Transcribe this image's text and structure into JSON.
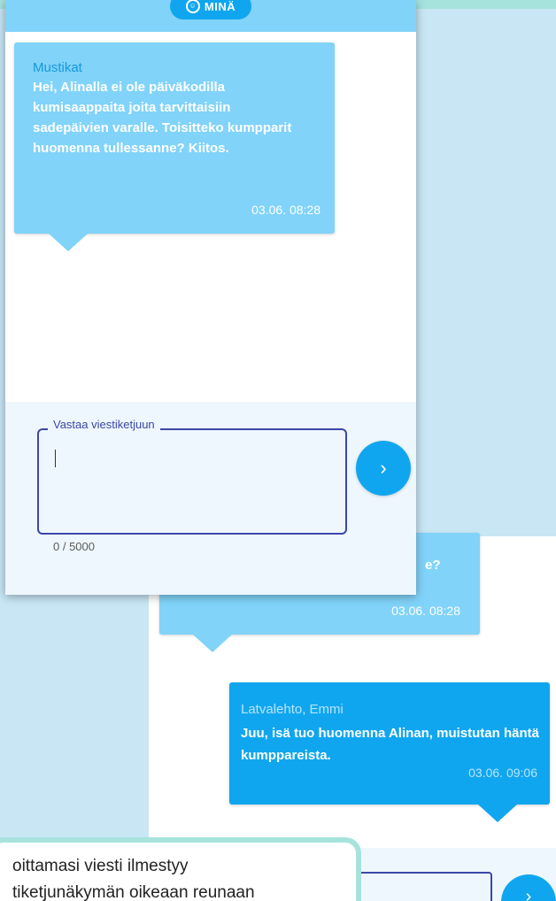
{
  "header": {
    "mina_label": "MINÄ",
    "face_icon": "☺"
  },
  "message": {
    "sender": "Mustikat",
    "body": "Hei, Alinalla ei ole päiväkodilla kumisaappaita joita tarvittaisiin sadepäivien varalle. Toisitteko kumpparit huomenna tullessanne? Kiitos.",
    "timestamp": "03.06. 08:28"
  },
  "compose": {
    "label": "Vastaa viestiketjuun",
    "counter": "0 / 5000",
    "send_icon": "›"
  },
  "background_thread": {
    "fragment": "e?",
    "timestamp": "03.06. 08:28",
    "reply": {
      "sender": "Latvalehto, Emmi",
      "body": "Juu, isä tuo huomenna Alinan, muistutan häntä kumppareista.",
      "timestamp": "03.06. 09:06"
    },
    "send_icon": "›"
  },
  "tooltip": {
    "line1": "oittamasi viesti ilmestyy",
    "line2": "tiketjunäkymän oikeaan reunaan"
  },
  "colors": {
    "teal": "#a6e3dd",
    "light_blue": "#81d3f9",
    "blue": "#10a6ef",
    "indigo": "#3b47a8"
  }
}
